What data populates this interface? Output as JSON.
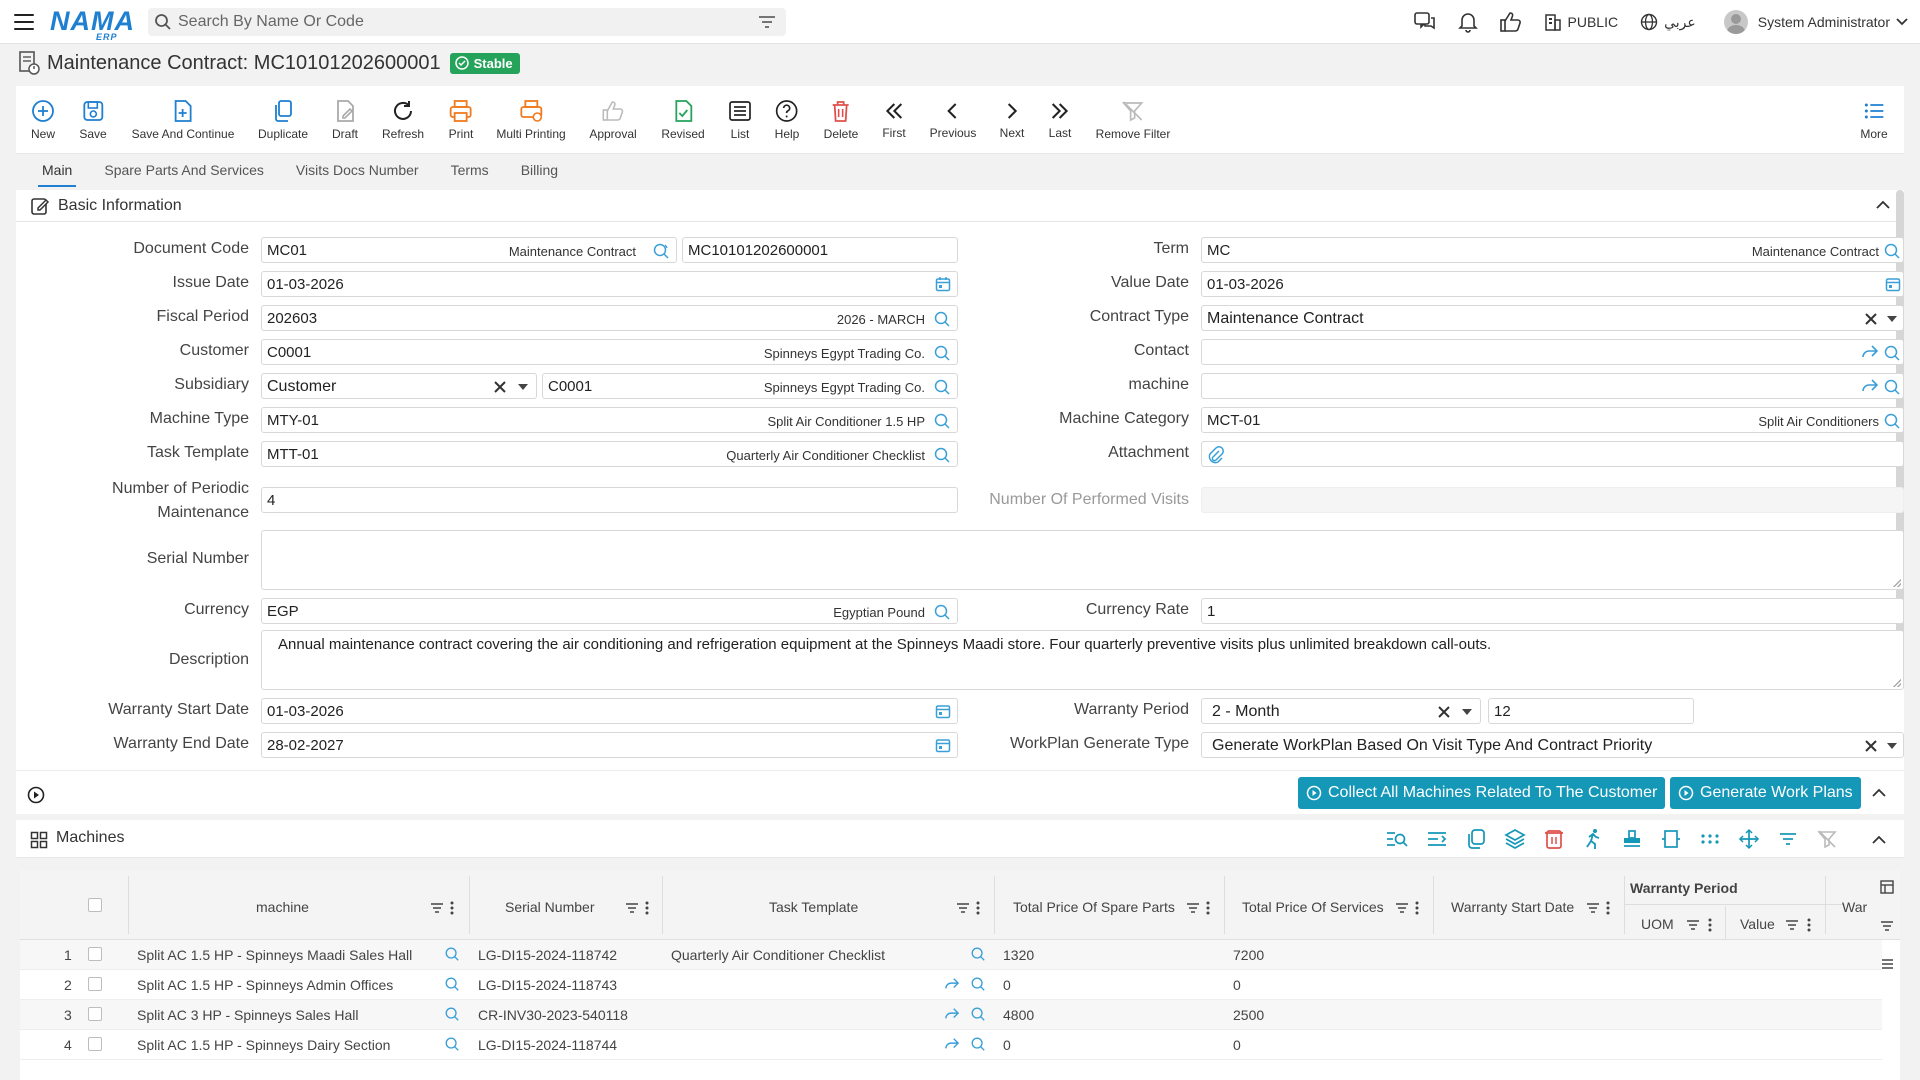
{
  "app": {
    "logo": "NAMA",
    "logo_sub": "ERP"
  },
  "search": {
    "placeholder": "Search By Name Or Code"
  },
  "topbar": {
    "branch": "PUBLIC",
    "language": "عربي",
    "user": "System Administrator"
  },
  "page": {
    "title": "Maintenance Contract: MC10101202600001",
    "status": "Stable"
  },
  "toolbar": {
    "new": "New",
    "save": "Save",
    "save_continue": "Save And Continue",
    "duplicate": "Duplicate",
    "draft": "Draft",
    "refresh": "Refresh",
    "print": "Print",
    "multi_printing": "Multi Printing",
    "approval": "Approval",
    "revised": "Revised",
    "list": "List",
    "help": "Help",
    "delete": "Delete",
    "first": "First",
    "previous": "Previous",
    "next": "Next",
    "last": "Last",
    "remove_filter": "Remove Filter",
    "more": "More"
  },
  "tabs": [
    "Main",
    "Spare Parts And Services",
    "Visits Docs Number",
    "Terms",
    "Billing"
  ],
  "section": {
    "title": "Basic Information"
  },
  "form": {
    "document_code": {
      "label": "Document Code",
      "code": "MC01",
      "name": "Maintenance Contract",
      "number": "MC10101202600001"
    },
    "term": {
      "label": "Term",
      "code": "MC",
      "name": "Maintenance Contract"
    },
    "issue_date": {
      "label": "Issue Date",
      "value": "01-03-2026"
    },
    "value_date": {
      "label": "Value Date",
      "value": "01-03-2026"
    },
    "fiscal_period": {
      "label": "Fiscal Period",
      "code": "202603",
      "name": "2026 - MARCH"
    },
    "contract_type": {
      "label": "Contract Type",
      "value": "Maintenance Contract"
    },
    "customer": {
      "label": "Customer",
      "code": "C0001",
      "name": "Spinneys Egypt Trading Co."
    },
    "contact": {
      "label": "Contact",
      "value": ""
    },
    "subsidiary": {
      "label": "Subsidiary",
      "type": "Customer",
      "code": "C0001",
      "name": "Spinneys Egypt Trading Co."
    },
    "machine": {
      "label": "machine",
      "value": ""
    },
    "machine_type": {
      "label": "Machine Type",
      "code": "MTY-01",
      "name": "Split Air Conditioner 1.5 HP"
    },
    "machine_category": {
      "label": "Machine Category",
      "code": "MCT-01",
      "name": "Split Air Conditioners"
    },
    "task_template": {
      "label": "Task Template",
      "code": "MTT-01",
      "name": "Quarterly Air Conditioner Checklist"
    },
    "attachment": {
      "label": "Attachment"
    },
    "periodic": {
      "label_1": "Number of Periodic",
      "label_2": "Maintenance",
      "value": "4"
    },
    "performed_visits": {
      "label": "Number Of Performed Visits",
      "value": ""
    },
    "serial_number": {
      "label": "Serial Number",
      "value": ""
    },
    "currency": {
      "label": "Currency",
      "code": "EGP",
      "name": "Egyptian Pound"
    },
    "currency_rate": {
      "label": "Currency Rate",
      "value": "1"
    },
    "description": {
      "label": "Description",
      "value": "Annual maintenance contract covering the air conditioning and refrigeration equipment at the Spinneys Maadi store. Four quarterly preventive visits plus unlimited breakdown call-outs."
    },
    "warranty_start": {
      "label": "Warranty Start Date",
      "value": "01-03-2026"
    },
    "warranty_period": {
      "label": "Warranty Period",
      "unit": "2 - Month",
      "value": "12"
    },
    "warranty_end": {
      "label": "Warranty End Date",
      "value": "28-02-2027"
    },
    "workplan_type": {
      "label": "WorkPlan Generate Type",
      "value": "Generate WorkPlan Based On Visit Type And Contract Priority"
    }
  },
  "actions": {
    "collect": "Collect All Machines Related To The Customer",
    "generate": "Generate Work Plans"
  },
  "machines": {
    "title": "Machines",
    "columns": {
      "machine": "machine",
      "serial": "Serial Number",
      "task": "Task Template",
      "spare": "Total Price Of Spare Parts",
      "services": "Total Price Of Services",
      "wstart": "Warranty Start Date",
      "wperiod": "Warranty Period",
      "uom": "UOM",
      "value": "Value",
      "warr": "Warr"
    },
    "rows": [
      {
        "n": "1",
        "machine": "Split AC 1.5 HP - Spinneys Maadi Sales Hall",
        "serial": "LG-DI15-2024-118742",
        "task": "Quarterly Air Conditioner Checklist",
        "spare": "1320",
        "services": "7200"
      },
      {
        "n": "2",
        "machine": "Split AC 1.5 HP - Spinneys Admin Offices",
        "serial": "LG-DI15-2024-118743",
        "task": "",
        "spare": "0",
        "services": "0"
      },
      {
        "n": "3",
        "machine": "Split AC 3 HP - Spinneys Sales Hall",
        "serial": "CR-INV30-2023-540118",
        "task": "",
        "spare": "4800",
        "services": "2500"
      },
      {
        "n": "4",
        "machine": "Split AC 1.5 HP - Spinneys Dairy Section",
        "serial": "LG-DI15-2024-118744",
        "task": "",
        "spare": "0",
        "services": "0"
      }
    ]
  },
  "colors": {
    "accent": "#1f7fd1",
    "stable": "#26a35b",
    "action": "#1597b8",
    "delete": "#e0504b",
    "print": "#f07a1e"
  }
}
